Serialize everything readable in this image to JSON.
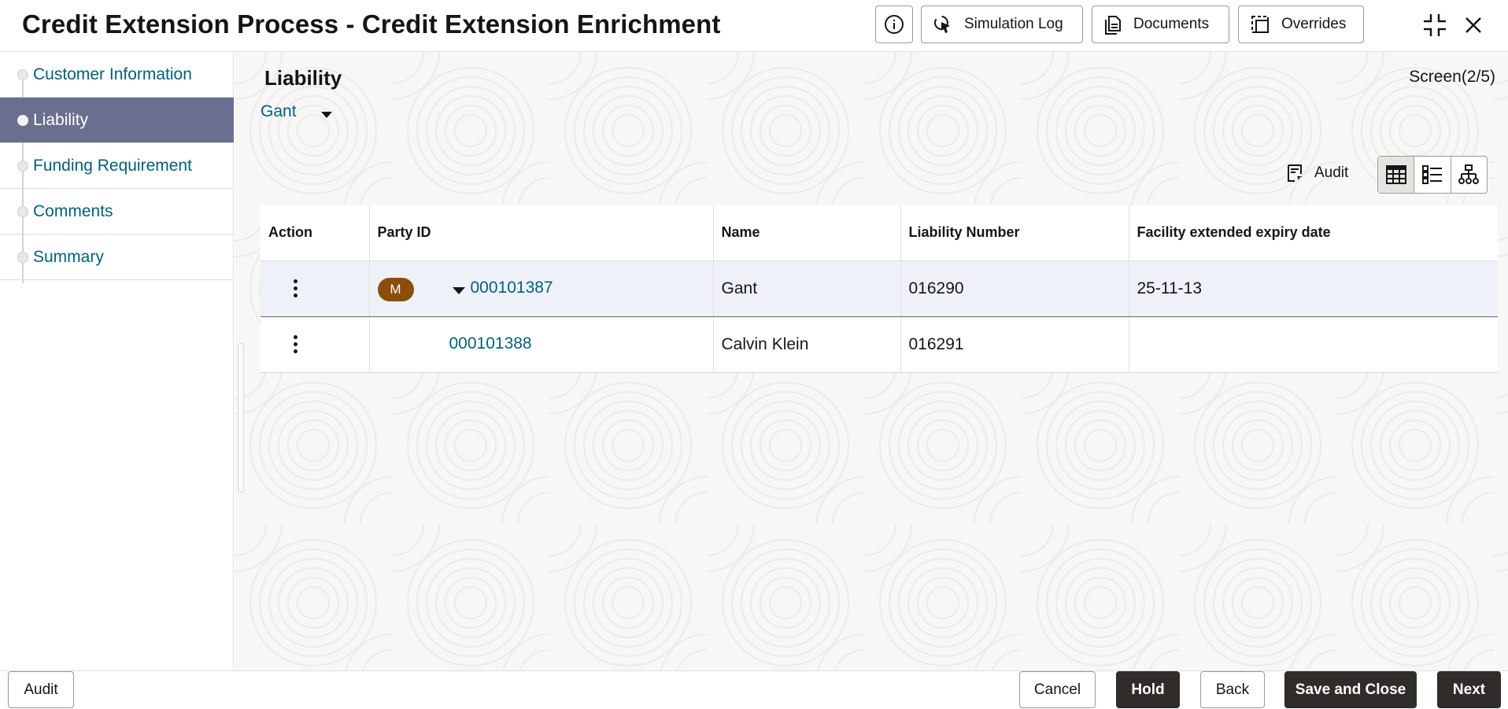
{
  "header": {
    "title": "Credit Extension Process - Credit Extension Enrichment",
    "buttons": {
      "simulation_log": "Simulation Log",
      "documents": "Documents",
      "overrides": "Overrides"
    }
  },
  "sidebar": {
    "items": [
      {
        "label": "Customer Information",
        "active": false
      },
      {
        "label": "Liability",
        "active": true
      },
      {
        "label": "Funding Requirement",
        "active": false
      },
      {
        "label": "Comments",
        "active": false
      },
      {
        "label": "Summary",
        "active": false
      }
    ]
  },
  "main": {
    "title": "Liability",
    "screen_indicator": "Screen(2/5)",
    "selector_value": "Gant",
    "audit_label": "Audit",
    "table": {
      "columns": [
        "Action",
        "Party ID",
        "Name",
        "Liability Number",
        "Facility extended expiry date"
      ],
      "rows": [
        {
          "badge": "M",
          "party_id": "000101387",
          "name": "Gant",
          "liability_number": "016290",
          "expiry": "25-11-13"
        },
        {
          "badge": "",
          "party_id": "000101388",
          "name": "Calvin Klein",
          "liability_number": "016291",
          "expiry": ""
        }
      ]
    }
  },
  "footer": {
    "audit": "Audit",
    "cancel": "Cancel",
    "hold": "Hold",
    "back": "Back",
    "save_close": "Save and Close",
    "next": "Next"
  },
  "colors": {
    "link": "#04607a",
    "active_nav": "#6a6f8f",
    "badge": "#8b4d0c",
    "primary_button": "#2f2c29"
  },
  "icons": [
    "info-icon",
    "simulation-log-icon",
    "documents-icon",
    "overrides-icon",
    "collapse-icon",
    "close-icon",
    "audit-icon",
    "table-view-icon",
    "list-view-icon",
    "tree-view-icon",
    "kebab-icon",
    "caret-down-icon"
  ]
}
